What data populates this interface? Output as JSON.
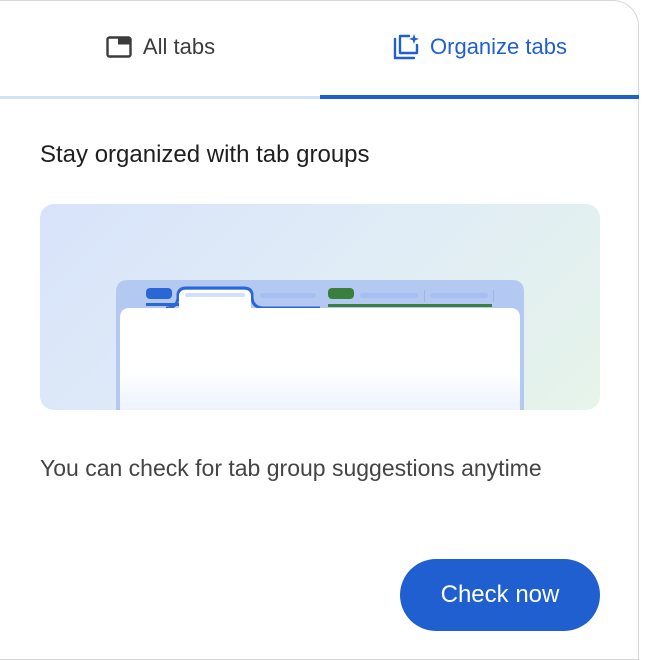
{
  "tabs": [
    {
      "label": "All tabs",
      "icon": "window-icon",
      "selected": false
    },
    {
      "label": "Organize tabs",
      "icon": "organize-tabs-icon",
      "selected": true
    }
  ],
  "content": {
    "title": "Stay organized with tab groups",
    "description": "You can check for tab group suggestions anytime",
    "check_button_label": "Check now"
  },
  "colors": {
    "accent": "#1f5fcf",
    "group_blue": "#2a67d4",
    "group_green": "#3a7f3d",
    "tab_strip": "#b4c9f2"
  }
}
